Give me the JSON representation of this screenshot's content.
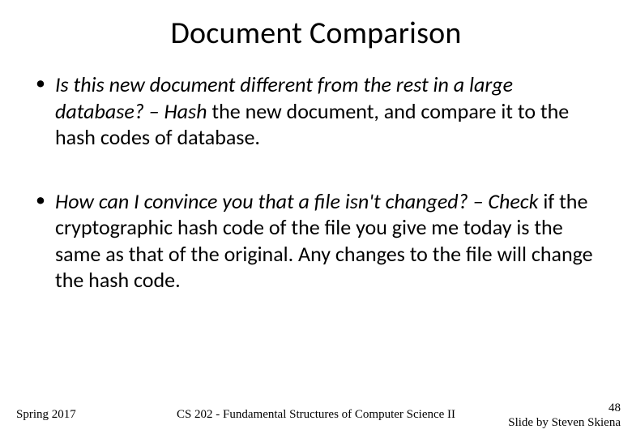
{
  "title": "Document Comparison",
  "bullets": [
    {
      "question": "Is this new document different from the rest in a large database?",
      "answer_lead": " – Hash",
      "answer_rest": " the new document, and compare it to the hash codes of database."
    },
    {
      "question": "How can I convince you that a file isn't changed?",
      "answer_lead": " – Check",
      "answer_rest": " if the cryptographic hash code of the file you give me today is the same as that of the original. Any changes to the file will change the hash code."
    }
  ],
  "footer": {
    "left": "Spring 2017",
    "center": "CS 202 - Fundamental Structures of Computer Science II",
    "page": "48",
    "credit": "Slide by Steven Skiena"
  }
}
